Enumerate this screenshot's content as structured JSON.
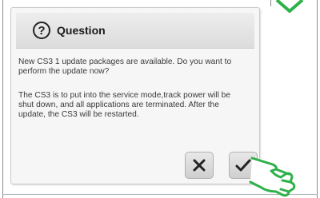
{
  "dialog": {
    "title": "Question",
    "message_line_1": "New CS3 1 update packages are available. Do you want to perform the update now?",
    "message_line_2": "The CS3 is to put into the service mode,track power will be shut down, and all applications are terminated. After the update, the CS3 will be restarted.",
    "icons": {
      "title": "question-circle-icon",
      "cancel": "close-x-icon",
      "confirm": "checkmark-icon",
      "pointer": "hand-pointer-icon"
    },
    "colors": {
      "accent_green": "#2fb14a"
    }
  }
}
